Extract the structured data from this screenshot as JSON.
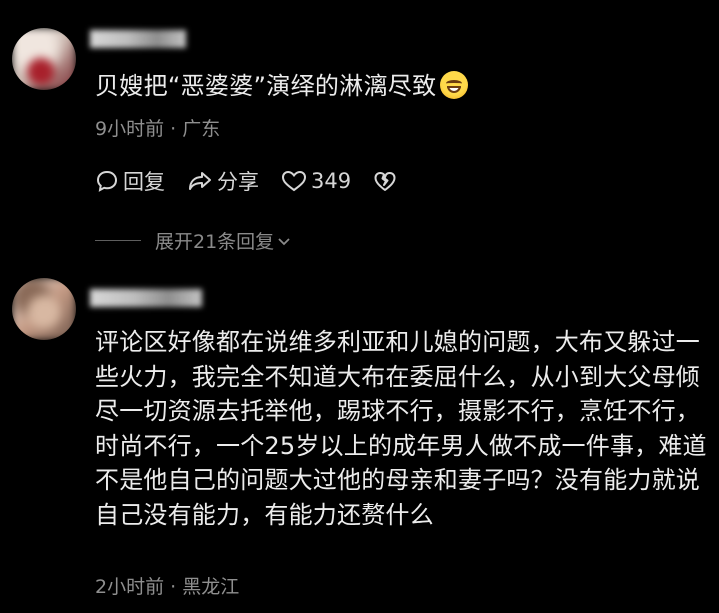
{
  "comments": [
    {
      "text": "贝嫂把“恶婆婆”演绎的淋漓尽致",
      "emoji": "grinning-sweat-emoji",
      "meta": "9小时前 · 广东",
      "actions": {
        "reply_label": "回复",
        "share_label": "分享",
        "like_count": "349"
      },
      "expand_label": "展开21条回复"
    },
    {
      "text": "评论区好像都在说维多利亚和儿媳的问题，大布又躲过一些火力，我完全不知道大布在委屈什么，从小到大父母倾尽一切资源去托举他，踢球不行，摄影不行，烹饪不行，时尚不行，一个25岁以上的成年男人做不成一件事，难道不是他自己的问题大过他的母亲和妻子吗？没有能力就说自己没有能力，有能力还赘什么",
      "meta": "2小时前 · 黑龙江"
    }
  ],
  "icons": [
    "reply-icon",
    "share-icon",
    "heart-icon",
    "dislike-icon",
    "chevron-down-icon"
  ],
  "colors": {
    "background": "#000000",
    "text": "#ececec",
    "meta": "#8f8f8f"
  }
}
